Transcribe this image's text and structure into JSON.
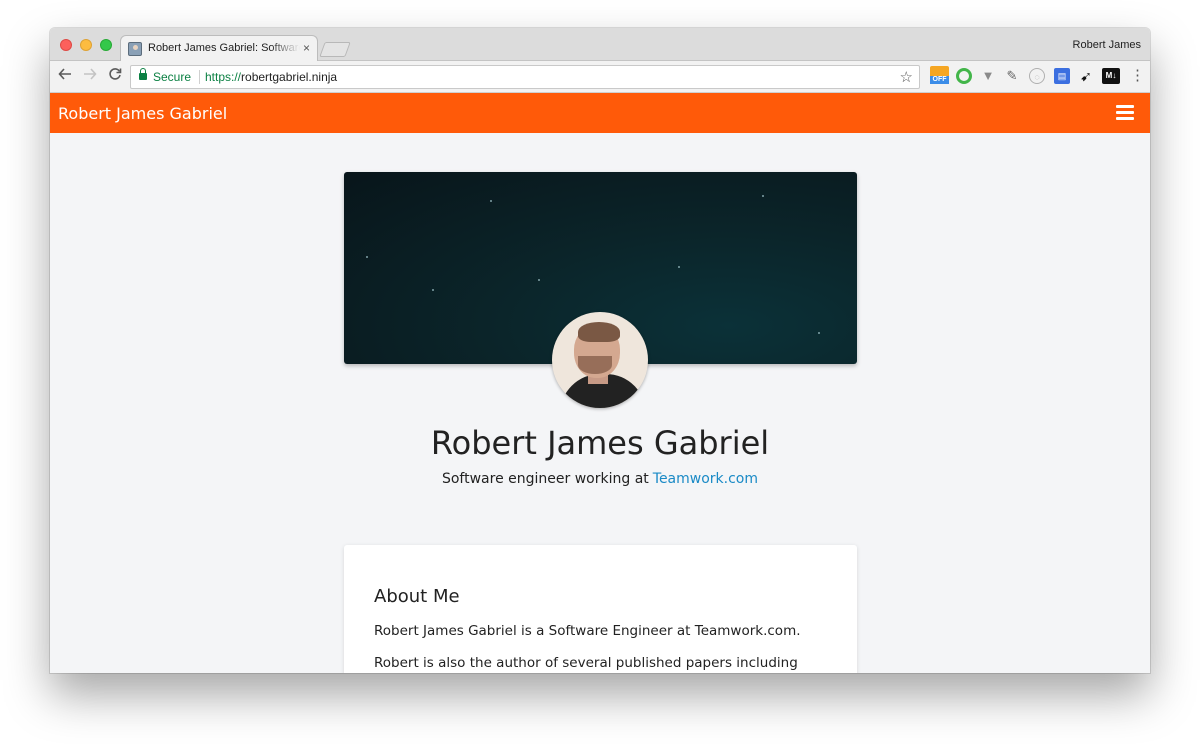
{
  "browser": {
    "tab_title": "Robert James Gabriel: Software Engineer",
    "tab_close": "×",
    "profile_name": "Robert James",
    "secure_label": "Secure",
    "url_scheme": "https://",
    "url_host": "robertgabriel.ninja",
    "honey_badge": "OFF",
    "ext_md_label": "M↓"
  },
  "site": {
    "brand": "Robert James Gabriel",
    "name": "Robert James Gabriel",
    "subtitle_prefix": "Software engineer working at",
    "subtitle_link": "Teamwork.com",
    "accent_color": "#ff5a09",
    "link_color": "#1a8ac6"
  },
  "about": {
    "heading": "About Me",
    "paragraphs": [
      "Robert James Gabriel is a Software Engineer at Teamwork.com.",
      "Robert is also the author of several published papers including"
    ]
  }
}
